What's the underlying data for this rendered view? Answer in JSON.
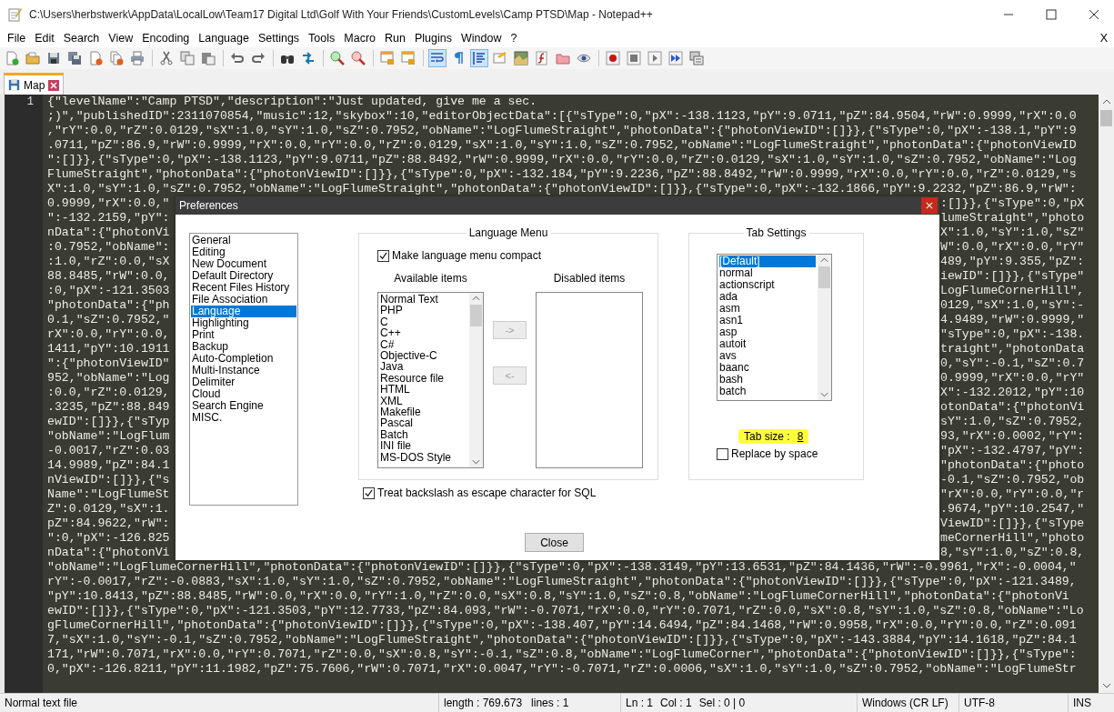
{
  "window": {
    "title": "C:\\Users\\herbstwerk\\AppData\\LocalLow\\Team17 Digital Ltd\\Golf With Your Friends\\CustomLevels\\Camp PTSD\\Map - Notepad++"
  },
  "menu": [
    "File",
    "Edit",
    "Search",
    "View",
    "Encoding",
    "Language",
    "Settings",
    "Tools",
    "Macro",
    "Run",
    "Plugins",
    "Window",
    "?"
  ],
  "menu_close": "X",
  "toolbar": [
    {
      "pressed": false
    },
    {
      "pressed": false
    },
    {
      "pressed": false
    },
    {
      "pressed": false
    },
    {
      "pressed": false
    },
    {
      "pressed": false
    },
    {
      "pressed": false
    },
    {
      "pressed": false
    },
    {
      "pressed": false
    },
    {
      "pressed": false
    },
    {
      "pressed": false
    },
    {
      "pressed": false
    },
    {
      "pressed": false
    },
    {
      "pressed": false
    },
    {
      "pressed": false
    },
    {
      "pressed": false
    },
    {
      "pressed": false
    },
    {
      "pressed": false
    },
    {
      "pressed": true
    },
    {
      "pressed": false
    },
    {
      "pressed": true
    },
    {
      "pressed": false
    },
    {
      "pressed": false
    },
    {
      "pressed": false
    },
    {
      "pressed": false
    },
    {
      "pressed": false
    },
    {
      "pressed": false
    },
    {
      "pressed": false
    },
    {
      "pressed": false
    },
    {
      "pressed": false
    },
    {
      "pressed": false
    }
  ],
  "tabs": [
    {
      "label": "Map",
      "selected": true
    }
  ],
  "editor": {
    "line_numbers": [
      "1"
    ],
    "lines": [
      {
        "kind": "full",
        "text": "{\"levelName\":\"Camp PTSD\",\"description\":\"Just updated, give me a sec."
      },
      {
        "kind": "full",
        "text": ";)\",\"publishedID\":2311070854,\"music\":12,\"skybox\":10,\"editorObjectData\":[{\"sType\":0,\"pX\":-138.1123,\"pY\":9.0711,\"pZ\":84.9504,\"rW\":0.9999,\"rX\":0.0"
      },
      {
        "kind": "full",
        "text": ",\"rY\":0.0,\"rZ\":0.0129,\"sX\":1.0,\"sY\":1.0,\"sZ\":0.7952,\"obName\":\"LogFlumeStraight\",\"photonData\":{\"photonViewID\":[]}},{\"sType\":0,\"pX\":-138.1,\"pY\":9"
      },
      {
        "kind": "full",
        "text": ".0711,\"pZ\":86.9,\"rW\":0.9999,\"rX\":0.0,\"rY\":0.0,\"rZ\":0.0129,\"sX\":1.0,\"sY\":1.0,\"sZ\":0.7952,\"obName\":\"LogFlumeStraight\",\"photonData\":{\"photonViewID"
      },
      {
        "kind": "full",
        "text": "\":[]}},{\"sType\":0,\"pX\":-138.1123,\"pY\":9.0711,\"pZ\":88.8492,\"rW\":0.9999,\"rX\":0.0,\"rY\":0.0,\"rZ\":0.0129,\"sX\":1.0,\"sY\":1.0,\"sZ\":0.7952,\"obName\":\"Log"
      },
      {
        "kind": "full",
        "text": "FlumeStraight\",\"photonData\":{\"photonViewID\":[]}},{\"sType\":0,\"pX\":-132.184,\"pY\":9.2236,\"pZ\":88.8492,\"rW\":0.9999,\"rX\":0.0,\"rY\":0.0,\"rZ\":0.0129,\"s"
      },
      {
        "kind": "full",
        "text": "X\":1.0,\"sY\":1.0,\"sZ\":0.7952,\"obName\":\"LogFlumeStraight\",\"photonData\":{\"photonViewID\":[]}},{\"sType\":0,\"pX\":-132.1866,\"pY\":9.2232,\"pZ\":86.9,\"rW\":"
      },
      {
        "kind": "split",
        "left": "0.9999,\"rX\":0.0,\"",
        "right": ":[]}},{\"sType\":0,\"pX"
      },
      {
        "kind": "split",
        "left": "\":-132.2159,\"pY\":",
        "right": "lumeStraight\",\"photo"
      },
      {
        "kind": "split",
        "left": "nData\":{\"photonVi",
        "right": "X\":1.0,\"sY\":1.0,\"sZ\""
      },
      {
        "kind": "split",
        "left": ":0.7952,\"obName\":",
        "right": "W\":0.0,\"rX\":0.0,\"rY\""
      },
      {
        "kind": "split",
        "left": ":1.0,\"rZ\":0.0,\"sX",
        "right": "489,\"pY\":9.355,\"pZ\":"
      },
      {
        "kind": "split",
        "left": "88.8485,\"rW\":0.0,",
        "right": "iewID\":[]}},{\"sType\""
      },
      {
        "kind": "split",
        "left": ":0,\"pX\":-121.3503",
        "right": "LogFlumeCornerHill\","
      },
      {
        "kind": "split",
        "left": "\"photonData\":{\"ph",
        "right": "0129,\"sX\":1.0,\"sY\":-"
      },
      {
        "kind": "split",
        "left": "0.1,\"sZ\":0.7952,\"",
        "right": "4.9489,\"rW\":0.9999,\""
      },
      {
        "kind": "split",
        "left": "rX\":0.0,\"rY\":0.0,",
        "right": "\"sType\":0,\"pX\":-138."
      },
      {
        "kind": "split",
        "left": "1411,\"pY\":10.1911",
        "right": "traight\",\"photonData"
      },
      {
        "kind": "split",
        "left": "\":{\"photonViewID\"",
        "right": "0,\"sY\":-0.1,\"sZ\":0.7"
      },
      {
        "kind": "split",
        "left": "952,\"obName\":\"Log",
        "right": "0.9999,\"rX\":0.0,\"rY\""
      },
      {
        "kind": "split",
        "left": ":0.0,\"rZ\":0.0129,",
        "right": "X\":-132.2012,\"pY\":10"
      },
      {
        "kind": "split",
        "left": ".3235,\"pZ\":88.849",
        "right": "otonData\":{\"photonVi"
      },
      {
        "kind": "split",
        "left": "ewID\":[]}},{\"sTyp",
        "right": "sY\":1.0,\"sZ\":0.7952,"
      },
      {
        "kind": "split",
        "left": "\"obName\":\"LogFlum",
        "right": "93,\"rX\":0.0002,\"rY\":"
      },
      {
        "kind": "split",
        "left": "-0.0017,\"rZ\":0.03",
        "right": "\"pX\":-132.4797,\"pY\":"
      },
      {
        "kind": "split",
        "left": "14.9989,\"pZ\":84.1",
        "right": "\"photonData\":{\"photo"
      },
      {
        "kind": "split",
        "left": "nViewID\":[]}},{\"s",
        "right": "-0.1,\"sZ\":0.7952,\"ob"
      },
      {
        "kind": "split",
        "left": "Name\":\"LogFlumeSt",
        "right": "\"rX\":0.0,\"rY\":0.0,\"r"
      },
      {
        "kind": "split",
        "left": "Z\":0.0129,\"sX\":1.",
        "right": ".9674,\"pY\":10.2547,\""
      },
      {
        "kind": "split",
        "left": "pZ\":84.9622,\"rW\":",
        "right": "ViewID\":[]}},{\"sType"
      },
      {
        "kind": "split",
        "left": "\":0,\"pX\":-126.825",
        "right": "meCornerHill\",\"photo"
      },
      {
        "kind": "split",
        "left": "nData\":{\"photonVi",
        "right": "8,\"sY\":1.0,\"sZ\":0.8,"
      },
      {
        "kind": "full",
        "text": "\"obName\":\"LogFlumeCornerHill\",\"photonData\":{\"photonViewID\":[]}},{\"sType\":0,\"pX\":-138.3149,\"pY\":13.6531,\"pZ\":84.1436,\"rW\":-0.9961,\"rX\":-0.0004,\""
      },
      {
        "kind": "full",
        "text": "rY\":-0.0017,\"rZ\":-0.0883,\"sX\":1.0,\"sY\":1.0,\"sZ\":0.7952,\"obName\":\"LogFlumeStraight\",\"photonData\":{\"photonViewID\":[]}},{\"sType\":0,\"pX\":-121.3489,"
      },
      {
        "kind": "full",
        "text": "\"pY\":10.8413,\"pZ\":88.8485,\"rW\":0.0,\"rX\":0.0,\"rY\":1.0,\"rZ\":0.0,\"sX\":0.8,\"sY\":1.0,\"sZ\":0.8,\"obName\":\"LogFlumeCornerHill\",\"photonData\":{\"photonVi"
      },
      {
        "kind": "full",
        "text": "ewID\":[]}},{\"sType\":0,\"pX\":-121.3503,\"pY\":12.7733,\"pZ\":84.093,\"rW\":-0.7071,\"rX\":0.0,\"rY\":0.7071,\"rZ\":0.0,\"sX\":0.8,\"sY\":1.0,\"sZ\":0.8,\"obName\":\"Lo"
      },
      {
        "kind": "full",
        "text": "gFlumeCornerHill\",\"photonData\":{\"photonViewID\":[]}},{\"sType\":0,\"pX\":-138.407,\"pY\":14.6494,\"pZ\":84.1468,\"rW\":0.9958,\"rX\":0.0,\"rY\":0.0,\"rZ\":0.091"
      },
      {
        "kind": "full",
        "text": "7,\"sX\":1.0,\"sY\":-0.1,\"sZ\":0.7952,\"obName\":\"LogFlumeStraight\",\"photonData\":{\"photonViewID\":[]}},{\"sType\":0,\"pX\":-143.3884,\"pY\":14.1618,\"pZ\":84.1"
      },
      {
        "kind": "full",
        "text": "171,\"rW\":0.7071,\"rX\":0.0,\"rY\":0.7071,\"rZ\":0.0,\"sX\":0.8,\"sY\":-0.1,\"sZ\":0.8,\"obName\":\"LogFlumeCorner\",\"photonData\":{\"photonViewID\":[]}},{\"sType\":"
      },
      {
        "kind": "full",
        "text": "0,\"pX\":-126.8211,\"pY\":11.1982,\"pZ\":75.7606,\"rW\":0.7071,\"rX\":0.0047,\"rY\":-0.7071,\"rZ\":0.0006,\"sX\":1.0,\"sY\":1.0,\"sZ\":0.7952,\"obName\":\"LogFlumeStr"
      }
    ]
  },
  "dialog": {
    "title": "Preferences",
    "categories": [
      {
        "label": "General",
        "selected": false
      },
      {
        "label": "Editing",
        "selected": false
      },
      {
        "label": "New Document",
        "selected": false
      },
      {
        "label": "Default Directory",
        "selected": false
      },
      {
        "label": "Recent Files History",
        "selected": false
      },
      {
        "label": "File Association",
        "selected": false
      },
      {
        "label": "Language",
        "selected": true
      },
      {
        "label": "Highlighting",
        "selected": false
      },
      {
        "label": "Print",
        "selected": false
      },
      {
        "label": "Backup",
        "selected": false
      },
      {
        "label": "Auto-Completion",
        "selected": false
      },
      {
        "label": "Multi-Instance",
        "selected": false
      },
      {
        "label": "Delimiter",
        "selected": false
      },
      {
        "label": "Cloud",
        "selected": false
      },
      {
        "label": "Search Engine",
        "selected": false
      },
      {
        "label": "MISC.",
        "selected": false
      }
    ],
    "language_menu": {
      "title": "Language Menu",
      "compact": {
        "label": "Make language menu compact",
        "checked": true
      },
      "available_title": "Available items",
      "disabled_title": "Disabled items",
      "available_items": [
        "Normal Text",
        "PHP",
        "C",
        "C++",
        "C#",
        "Objective-C",
        "Java",
        "Resource file",
        "HTML",
        "XML",
        "Makefile",
        "Pascal",
        "Batch",
        "INI file",
        "MS-DOS Style"
      ],
      "add_button": {
        "label": "->",
        "disabled": true
      },
      "remove_button": {
        "label": "<-",
        "disabled": true
      }
    },
    "sql_option": {
      "label": "Treat backslash as escape character for SQL",
      "checked": true
    },
    "tab_settings": {
      "title": "Tab Settings",
      "languages": [
        {
          "label": "[Default]",
          "selected": true
        },
        {
          "label": "normal",
          "selected": false
        },
        {
          "label": "actionscript",
          "selected": false
        },
        {
          "label": "ada",
          "selected": false
        },
        {
          "label": "asm",
          "selected": false
        },
        {
          "label": "asn1",
          "selected": false
        },
        {
          "label": "asp",
          "selected": false
        },
        {
          "label": "autoit",
          "selected": false
        },
        {
          "label": "avs",
          "selected": false
        },
        {
          "label": "baanc",
          "selected": false
        },
        {
          "label": "bash",
          "selected": false
        },
        {
          "label": "batch",
          "selected": false
        }
      ],
      "tab_size_label": "Tab size :",
      "tab_size": "8",
      "tab_size_highlighted": true,
      "replace_by_space": {
        "label": "Replace by space",
        "checked": false
      }
    },
    "close_button": "Close"
  },
  "status_bar": {
    "file_type": "Normal text file",
    "length": "length : 769.673",
    "lines": "lines : 1",
    "ln": "Ln : 1",
    "col": "Col : 1",
    "sel": "Sel : 0 | 0",
    "eol": "Windows (CR LF)",
    "encoding": "UTF-8",
    "mode": "INS"
  }
}
